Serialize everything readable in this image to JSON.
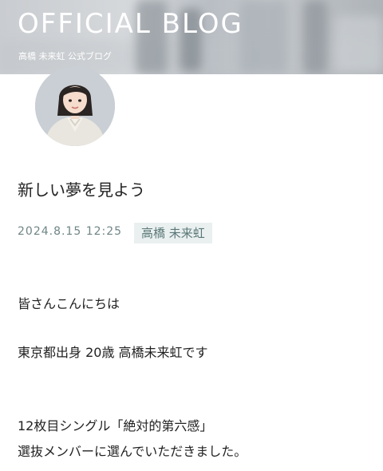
{
  "header": {
    "title": "OFFICIAL BLOG",
    "subtitle": "高橋 未来虹 公式ブログ"
  },
  "post": {
    "title": "新しい夢を見よう",
    "date": "2024.8.15 12:25",
    "author": "高橋 未来虹",
    "body": [
      "皆さんこんにちは",
      "東京都出身 20歳 高橋未来虹です",
      "12枚目シングル「絶対的第六感」",
      "選抜メンバーに選んでいただきました。"
    ]
  }
}
